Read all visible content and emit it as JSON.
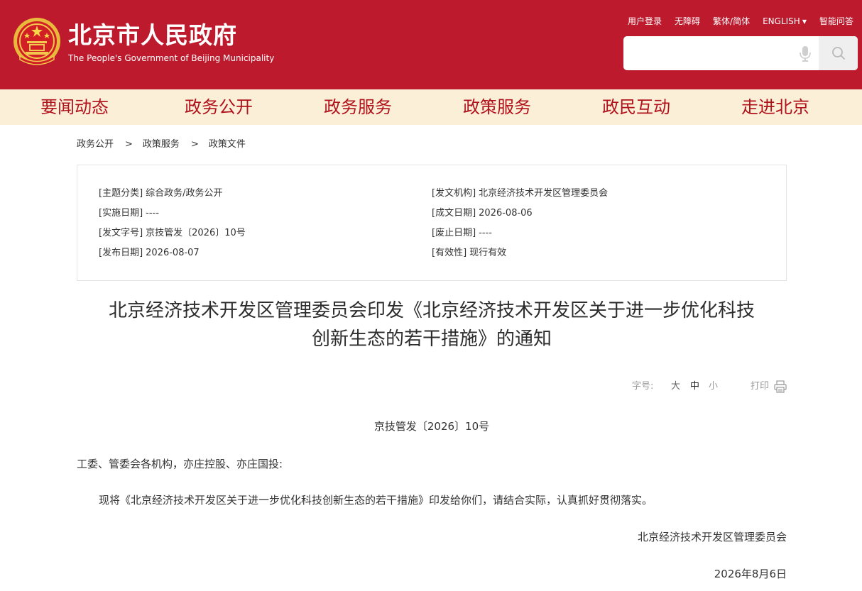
{
  "header": {
    "title": "北京市人民政府",
    "subtitle": "The People's Government of Beijing Municipality",
    "links": {
      "login": "用户登录",
      "accessibility": "无障碍",
      "traditional": "繁体/简体",
      "english": "ENGLISH",
      "qa": "智能问答"
    },
    "search": {
      "placeholder": ""
    },
    "brand_color": "#bd1a2d"
  },
  "nav": {
    "items": [
      "要闻动态",
      "政务公开",
      "政务服务",
      "政策服务",
      "政民互动",
      "走进北京"
    ],
    "background": "#fbefd8",
    "text_color": "#b0111b"
  },
  "breadcrumb": {
    "items": [
      "政务公开",
      "政策服务",
      "政策文件"
    ],
    "separator": ">"
  },
  "meta": {
    "topic": {
      "label": "[主题分类]",
      "value": "综合政务/政务公开"
    },
    "effective_date": {
      "label": "[实施日期]",
      "value": "----"
    },
    "doc_number": {
      "label": "[发文字号]",
      "value": "京技管发〔2026〕10号"
    },
    "publish_date": {
      "label": "[发布日期]",
      "value": "2026-08-07"
    },
    "issuer": {
      "label": "[发文机构]",
      "value": "北京经济技术开发区管理委员会"
    },
    "written_date": {
      "label": "[成文日期]",
      "value": "2026-08-06"
    },
    "abolish_date": {
      "label": "[废止日期]",
      "value": "----"
    },
    "validity": {
      "label": "[有效性]",
      "value": "现行有效"
    }
  },
  "article": {
    "title_line1": "北京经济技术开发区管理委员会印发《北京经济技术开发区关于进一步优化科技",
    "title_line2": "创新生态的若干措施》的通知",
    "tools": {
      "font_size_label": "字号:",
      "large": "大",
      "medium": "中",
      "small": "小",
      "print": "打印"
    },
    "doc_number": "京技管发〔2026〕10号",
    "recipients": "工委、管委会各机构，亦庄控股、亦庄国投:",
    "body": "现将《北京经济技术开发区关于进一步优化科技创新生态的若干措施》印发给你们，请结合实际，认真抓好贯彻落实。",
    "signature": "北京经济技术开发区管理委员会",
    "date": "2026年8月6日"
  }
}
